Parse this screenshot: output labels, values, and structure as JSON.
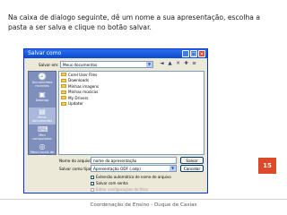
{
  "instruction": "Na caixa de dialogo seguinte, dê um nome a sua apresentação, escolha a pasta a ser salva e clique no botão salvar.",
  "dialog": {
    "title": "Salvar como",
    "title_buttons": [
      "_",
      "□",
      "×"
    ],
    "save_in_label": "Salvar em:",
    "save_in_value": "Meus documentos",
    "places": [
      {
        "label": "Documentos recentes",
        "icon": "recent-documents-icon"
      },
      {
        "label": "Desktop",
        "icon": "desktop-icon"
      },
      {
        "label": "Meus documentos",
        "icon": "my-documents-icon"
      },
      {
        "label": "Meu computador",
        "icon": "my-computer-icon"
      },
      {
        "label": "Meus locais de rede",
        "icon": "network-places-icon"
      }
    ],
    "files": [
      "Corel User Files",
      "Downloads",
      "Minhas imagens",
      "Minhas músicas",
      "My Drivers",
      "Updater"
    ],
    "filename_label": "Nome do arquivo:",
    "filename_value": "nome da apresentação",
    "filetype_label": "Salvar como tipo:",
    "filetype_value": "Apresentação ODF (.odp)",
    "save_button": "Salvar",
    "cancel_button": "Cancelar",
    "checkboxes": [
      {
        "label": "Extensão automática de nome de arquivo",
        "checked": true
      },
      {
        "label": "Salvar com senha",
        "checked": false
      },
      {
        "label": "Editar configurações do filtro",
        "checked": false
      }
    ]
  },
  "slide_number": "15",
  "footer": "Coordenação de Ensino - Duque de Caxias"
}
